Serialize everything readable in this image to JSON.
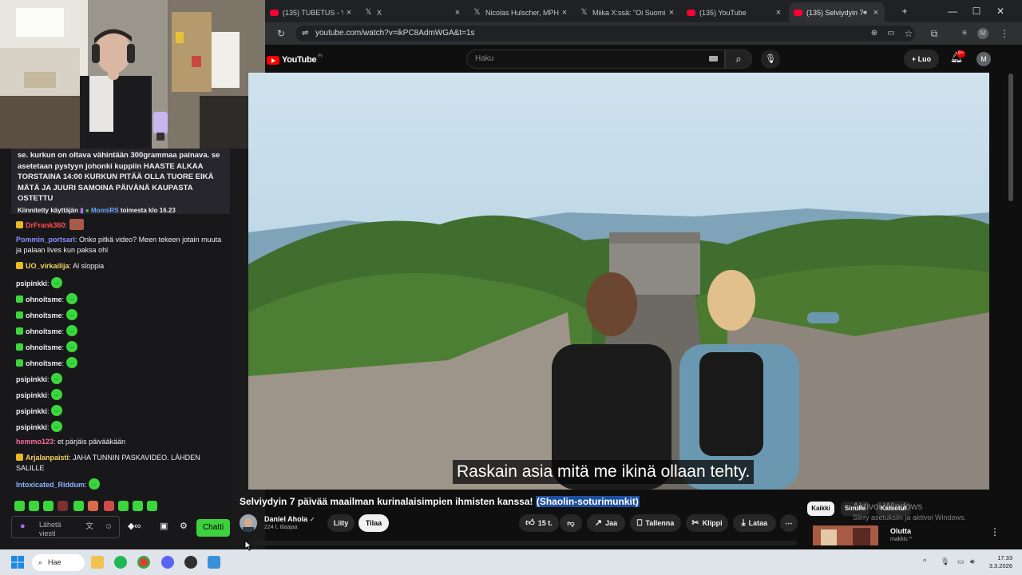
{
  "browser": {
    "tabs": [
      {
        "title": "(135) TUBETUS - YouTube",
        "icon": "youtube-icon"
      },
      {
        "title": "X",
        "icon": "x-icon"
      },
      {
        "title": "Nicolas Hulscher, MPH X",
        "icon": "x-icon"
      },
      {
        "title": "Miika X:ssä: \"Oi Suomi o",
        "icon": "x-icon"
      },
      {
        "title": "(135) YouTube",
        "icon": "youtube-icon"
      },
      {
        "title": "(135) Selviydyin 7 pä",
        "icon": "youtube-icon",
        "active": true
      }
    ],
    "url": "youtube.com/watch?v=ikPC8AdmWGA&t=1s",
    "profile_initial": "M"
  },
  "youtube": {
    "logo_text": "YouTube",
    "region": "FI",
    "search_placeholder": "Haku",
    "create_label": "Luo",
    "notifications": "9+",
    "avatar_initial": "M",
    "subtitle": "Raskain asia mitä me ikinä ollaan tehty.",
    "video_title_main": "Selviydyin 7 päivää maailman kurinalaisimpien ihmisten kanssa! ",
    "video_title_highlight": "(Shaolin-soturimunkit)",
    "channel_name": "Daniel Ahola",
    "channel_subs": "224 t. tilaajaa",
    "join_label": "Liity",
    "subscribe_label": "Tilaa",
    "likes": "15 t.",
    "share_label": "Jaa",
    "save_label": "Tallenna",
    "clip_label": "Klippi",
    "download_label": "Lataa",
    "filters": [
      "Kaikki",
      "Sinulle",
      "Katsotut"
    ],
    "rec_title": "Olutta",
    "rec_channel": "makkis ^"
  },
  "windows_watermark": {
    "line1": "Aktivoi Windows",
    "line2": "Siirry asetuksiin ja aktivoi Windows."
  },
  "chat": {
    "pinned_text": "se. kurkun on oltava vähintään 300grammaa painava. se asetetaan pystyyn johonki kuppiin HAASTE ALKAA TORSTAINA 14:00 KURKUN PITÄÄ OLLA TUORE EIKÄ MÄTÄ JA JUURI SAMOINA PÄIVÄNÄ KAUPASTA OSTETTU",
    "pinned_by_prefix": "Kiinnitetty käyttäjän",
    "pinned_by_name": "MonniRS",
    "pinned_by_suffix": "toimesta klo 16.23",
    "messages": [
      {
        "user": "DrFrank360",
        "color": "#ff4f4f",
        "text": "",
        "badge": "#e8b923"
      },
      {
        "user": "Pommin_portsari",
        "color": "#8a8cff",
        "text": "Onko pitkä video? Meen tekeen jotain muuta ja palaan lives kun paksa ohi",
        "badge": ""
      },
      {
        "user": "UO_virkailija",
        "color": "#f4d35e",
        "text": "Al sloppia",
        "badge": "#e8b923"
      },
      {
        "user": "psipinkki",
        "color": "#efeff1",
        "text": "",
        "badge": ""
      },
      {
        "user": "ohnoitsme",
        "color": "#efeff1",
        "text": "",
        "badge": "#3bd63b"
      },
      {
        "user": "ohnoitsme",
        "color": "#efeff1",
        "text": "",
        "badge": "#3bd63b"
      },
      {
        "user": "ohnoitsme",
        "color": "#efeff1",
        "text": "",
        "badge": "#3bd63b"
      },
      {
        "user": "ohnoitsme",
        "color": "#efeff1",
        "text": "",
        "badge": "#3bd63b"
      },
      {
        "user": "ohnoitsme",
        "color": "#efeff1",
        "text": "",
        "badge": "#3bd63b"
      },
      {
        "user": "psipinkki",
        "color": "#efeff1",
        "text": "",
        "badge": ""
      },
      {
        "user": "psipinkki",
        "color": "#efeff1",
        "text": "",
        "badge": ""
      },
      {
        "user": "psipinkki",
        "color": "#efeff1",
        "text": "",
        "badge": ""
      },
      {
        "user": "psipinkki",
        "color": "#efeff1",
        "text": "",
        "badge": ""
      },
      {
        "user": "hemmo123",
        "color": "#ff6b9a",
        "text": "et pärjäis päivääkään",
        "badge": ""
      },
      {
        "user": "Arjalanpaisti",
        "color": "#f4d35e",
        "text": "JAHA TUNNIN PASKAVIDEO. LÄHDEN SALILLE",
        "badge": "#e8b923"
      },
      {
        "user": "Intoxicated_Riddum",
        "color": "#8ab4ff",
        "text": "",
        "badge": ""
      }
    ],
    "input_placeholder": "Lähetä viesti",
    "send_label": "Chatti"
  },
  "taskbar": {
    "search_label": "Hae",
    "time": "17.33",
    "date": "3.3.2026"
  }
}
